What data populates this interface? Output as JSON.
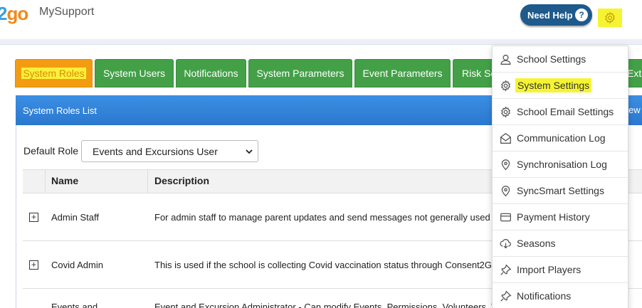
{
  "header": {
    "logo_two": "2",
    "logo_go": "go",
    "app_title": "MySupport",
    "need_help_label": "Need Help",
    "help_glyph": "?"
  },
  "tabs": [
    {
      "label": "System Roles",
      "active": true
    },
    {
      "label": "System Users"
    },
    {
      "label": "Notifications"
    },
    {
      "label": "System Parameters"
    },
    {
      "label": "Event Parameters"
    },
    {
      "label": "Risk Se"
    },
    {
      "label": "Exte"
    }
  ],
  "list": {
    "title": "System Roles List",
    "new_button_fragment": "ew"
  },
  "default_role": {
    "label": "Default Role",
    "selected": "Events and Excursions User"
  },
  "table": {
    "columns": [
      "Name",
      "Description"
    ],
    "rows": [
      {
        "name": "Admin Staff",
        "description": "For admin staff to manage parent updates and send messages not generally used"
      },
      {
        "name": "Covid Admin",
        "description": "This is used if the school is collecting Covid vaccination status through Consent2G"
      },
      {
        "name": "Events and",
        "description": "Event and Excursion Administrator - Can modify Events, Permissions, Volunteers, T"
      }
    ],
    "expand_glyph": "+"
  },
  "settings_menu": {
    "items": [
      {
        "label": "School Settings",
        "icon": "user-icon"
      },
      {
        "label": "System Settings",
        "icon": "gear-icon",
        "highlighted": true
      },
      {
        "label": "School Email Settings",
        "icon": "gear-icon"
      },
      {
        "label": "Communication Log",
        "icon": "envelope-open-icon"
      },
      {
        "label": "Synchronisation Log",
        "icon": "location-pin-icon"
      },
      {
        "label": "SyncSmart Settings",
        "icon": "location-pin-icon"
      },
      {
        "label": "Payment History",
        "icon": "credit-card-icon"
      },
      {
        "label": "Seasons",
        "icon": "cloud-download-icon"
      },
      {
        "label": "Import Players",
        "icon": "pushpin-icon"
      },
      {
        "label": "Notifications",
        "icon": "pushpin-icon"
      }
    ]
  },
  "colors": {
    "tab_green": "#43a047",
    "tab_active": "#f39c12",
    "highlight_yellow": "#f6f432",
    "list_bar_blue": "#2b78cf",
    "need_help_bg": "#1e5a8c"
  }
}
